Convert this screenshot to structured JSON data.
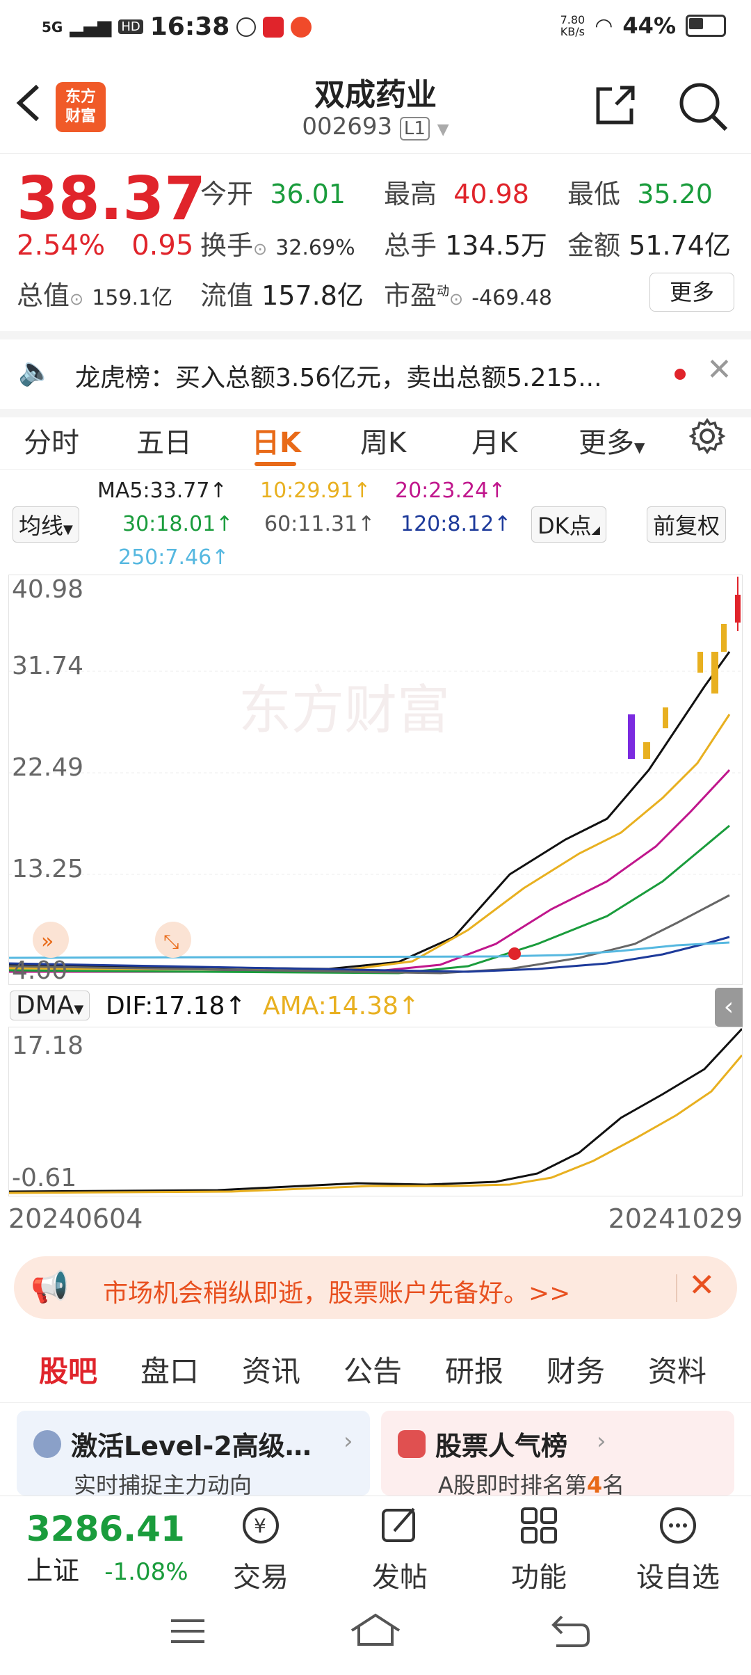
{
  "status": {
    "network": "5G",
    "hd": "HD",
    "time": "16:38",
    "speed_value": "7.80",
    "speed_unit": "KB/s",
    "battery": "44%"
  },
  "header": {
    "title": "双成药业",
    "code": "002693",
    "level": "L1",
    "logo_line1": "东方",
    "logo_line2": "财富"
  },
  "quote": {
    "price": "38.37",
    "pct": "2.54%",
    "change": "0.95",
    "open_label": "今开",
    "open": "36.01",
    "high_label": "最高",
    "high": "40.98",
    "low_label": "最低",
    "low": "35.20",
    "turnover_label": "换手",
    "turnover": "32.69%",
    "volume_label": "总手",
    "volume": "134.5万",
    "amount_label": "金额",
    "amount": "51.74亿",
    "mcap_label": "总值",
    "mcap": "159.1亿",
    "float_label": "流值",
    "float": "157.8亿",
    "pe_label": "市盈",
    "pe_sup": "动",
    "pe": "-469.48",
    "more": "更多"
  },
  "news": {
    "text": "龙虎榜：买入总额3.56亿元，卖出总额5.215..."
  },
  "tabs": [
    "分时",
    "五日",
    "日K",
    "周K",
    "月K",
    "更多"
  ],
  "active_tab": "日K",
  "ma": {
    "selector": "均线",
    "dk": "DK点",
    "adjust": "前复权",
    "ma5": "MA5:33.77↑",
    "ma10": "10:29.91↑",
    "ma20": "20:23.24↑",
    "ma30": "30:18.01↑",
    "ma60": "60:11.31↑",
    "ma120": "120:8.12↑",
    "ma250": "250:7.46↑"
  },
  "chart": {
    "y_labels": [
      "40.98",
      "31.74",
      "22.49",
      "13.25",
      "4.00"
    ],
    "watermark": "东方财富"
  },
  "indicator": {
    "name": "DMA",
    "dif": "DIF:17.18↑",
    "ama": "AMA:14.38↑",
    "y_top": "17.18",
    "y_bottom": "-0.61"
  },
  "dates": {
    "start": "20240604",
    "end": "20241029"
  },
  "promo": {
    "text": "市场机会稍纵即逝，股票账户先备好。>>"
  },
  "tabs2": [
    "股吧",
    "盘口",
    "资讯",
    "公告",
    "研报",
    "财务",
    "资料"
  ],
  "cards": [
    {
      "title": "激活Level-2高级…",
      "sub": "实时捕捉主力动向"
    },
    {
      "title": "股票人气榜",
      "sub_pre": "A股即时排名第",
      "sub_num": "4",
      "sub_post": "名"
    }
  ],
  "bottom_nav": {
    "index_value": "3286.41",
    "index_name": "上证",
    "index_pct": "-1.08%",
    "items": [
      "交易",
      "发帖",
      "功能",
      "设自选"
    ]
  },
  "colors": {
    "red": "#e0242b",
    "green": "#1a9c3c",
    "orange": "#e86a18"
  }
}
